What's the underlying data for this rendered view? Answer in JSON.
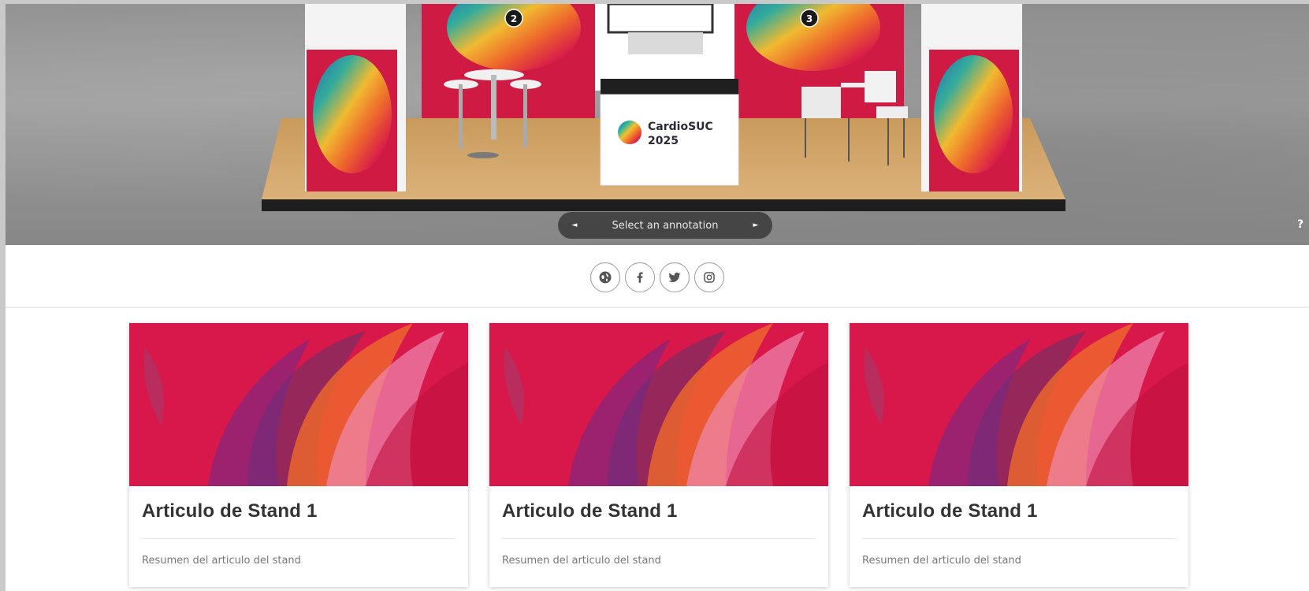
{
  "viewer": {
    "annotation_label": "Select an annotation",
    "prev_label": "◄",
    "next_label": "►",
    "help_label": "?",
    "annotation_markers": [
      "2",
      "3"
    ],
    "booth_brand": {
      "name": "CardioSUC",
      "year": "2025"
    }
  },
  "social": {
    "items": [
      {
        "name": "website",
        "icon": "globe-icon"
      },
      {
        "name": "facebook",
        "icon": "facebook-icon"
      },
      {
        "name": "twitter",
        "icon": "twitter-icon"
      },
      {
        "name": "instagram",
        "icon": "instagram-icon"
      }
    ]
  },
  "cards": [
    {
      "title": "Articulo de Stand 1",
      "summary": "Resumen del articulo del stand"
    },
    {
      "title": "Articulo de Stand 1",
      "summary": "Resumen del articulo del stand"
    },
    {
      "title": "Articulo de Stand 1",
      "summary": "Resumen del articulo del stand"
    }
  ],
  "colors": {
    "brand_red": "#d91a4a",
    "floor_wood": "#d2a66b",
    "viewer_grey": "#959595",
    "annotation_bg": "#3a3a3a"
  }
}
